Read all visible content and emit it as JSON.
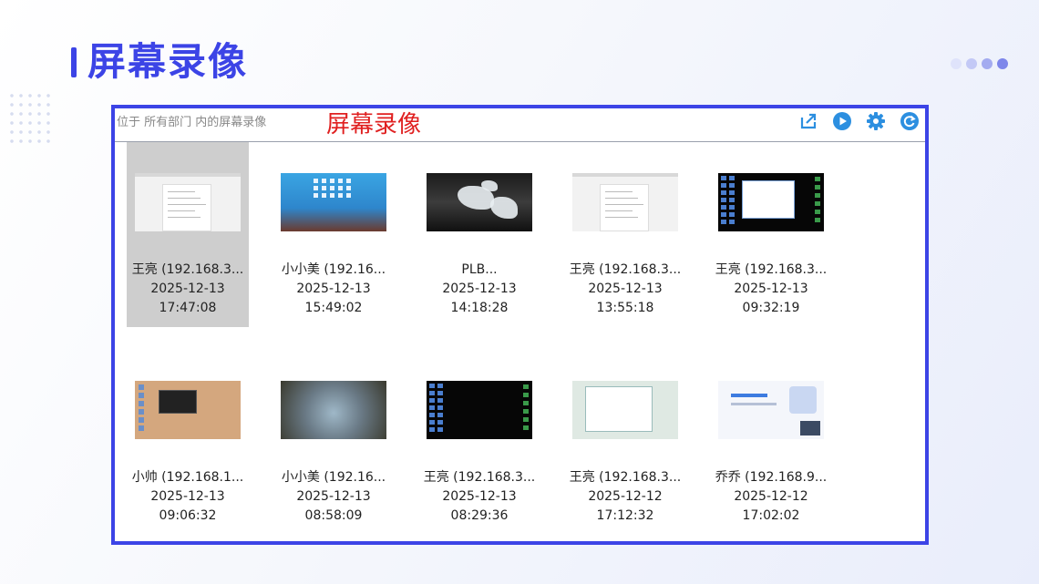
{
  "page": {
    "title": "屏幕录像",
    "accent": "#3c44e6",
    "decor_dots": [
      "#dfe3fb",
      "#c3c9f6",
      "#a3abf0",
      "#7d86ea"
    ]
  },
  "header": {
    "location": "位于 所有部门 内的屏幕录像",
    "overlay_title": "屏幕录像",
    "overlay_color": "#e02020"
  },
  "toolbar": [
    {
      "icon": "export-icon"
    },
    {
      "icon": "play-icon"
    },
    {
      "icon": "gear-icon"
    },
    {
      "icon": "refresh-icon"
    }
  ],
  "recordings": [
    {
      "name": "王亮 (192.168.3...",
      "date": "2025-12-13",
      "time": "17:47:08",
      "thumb": "doc",
      "selected": true
    },
    {
      "name": "小小美 (192.16...",
      "date": "2025-12-13",
      "time": "15:49:02",
      "thumb": "blue"
    },
    {
      "name": "PLB...",
      "date": "2025-12-13",
      "time": "14:18:28",
      "thumb": "ice"
    },
    {
      "name": "王亮 (192.168.3...",
      "date": "2025-12-13",
      "time": "13:55:18",
      "thumb": "doc"
    },
    {
      "name": "王亮 (192.168.3...",
      "date": "2025-12-13",
      "time": "09:32:19",
      "thumb": "dark"
    },
    {
      "name": "小帅 (192.168.1...",
      "date": "2025-12-13",
      "time": "09:06:32",
      "thumb": "tan"
    },
    {
      "name": "小小美 (192.16...",
      "date": "2025-12-13",
      "time": "08:58:09",
      "thumb": "art"
    },
    {
      "name": "王亮 (192.168.3...",
      "date": "2025-12-13",
      "time": "08:29:36",
      "thumb": "dark2"
    },
    {
      "name": "王亮 (192.168.3...",
      "date": "2025-12-12",
      "time": "17:12:32",
      "thumb": "green"
    },
    {
      "name": "乔乔 (192.168.9...",
      "date": "2025-12-12",
      "time": "17:02:02",
      "thumb": "lite"
    }
  ]
}
